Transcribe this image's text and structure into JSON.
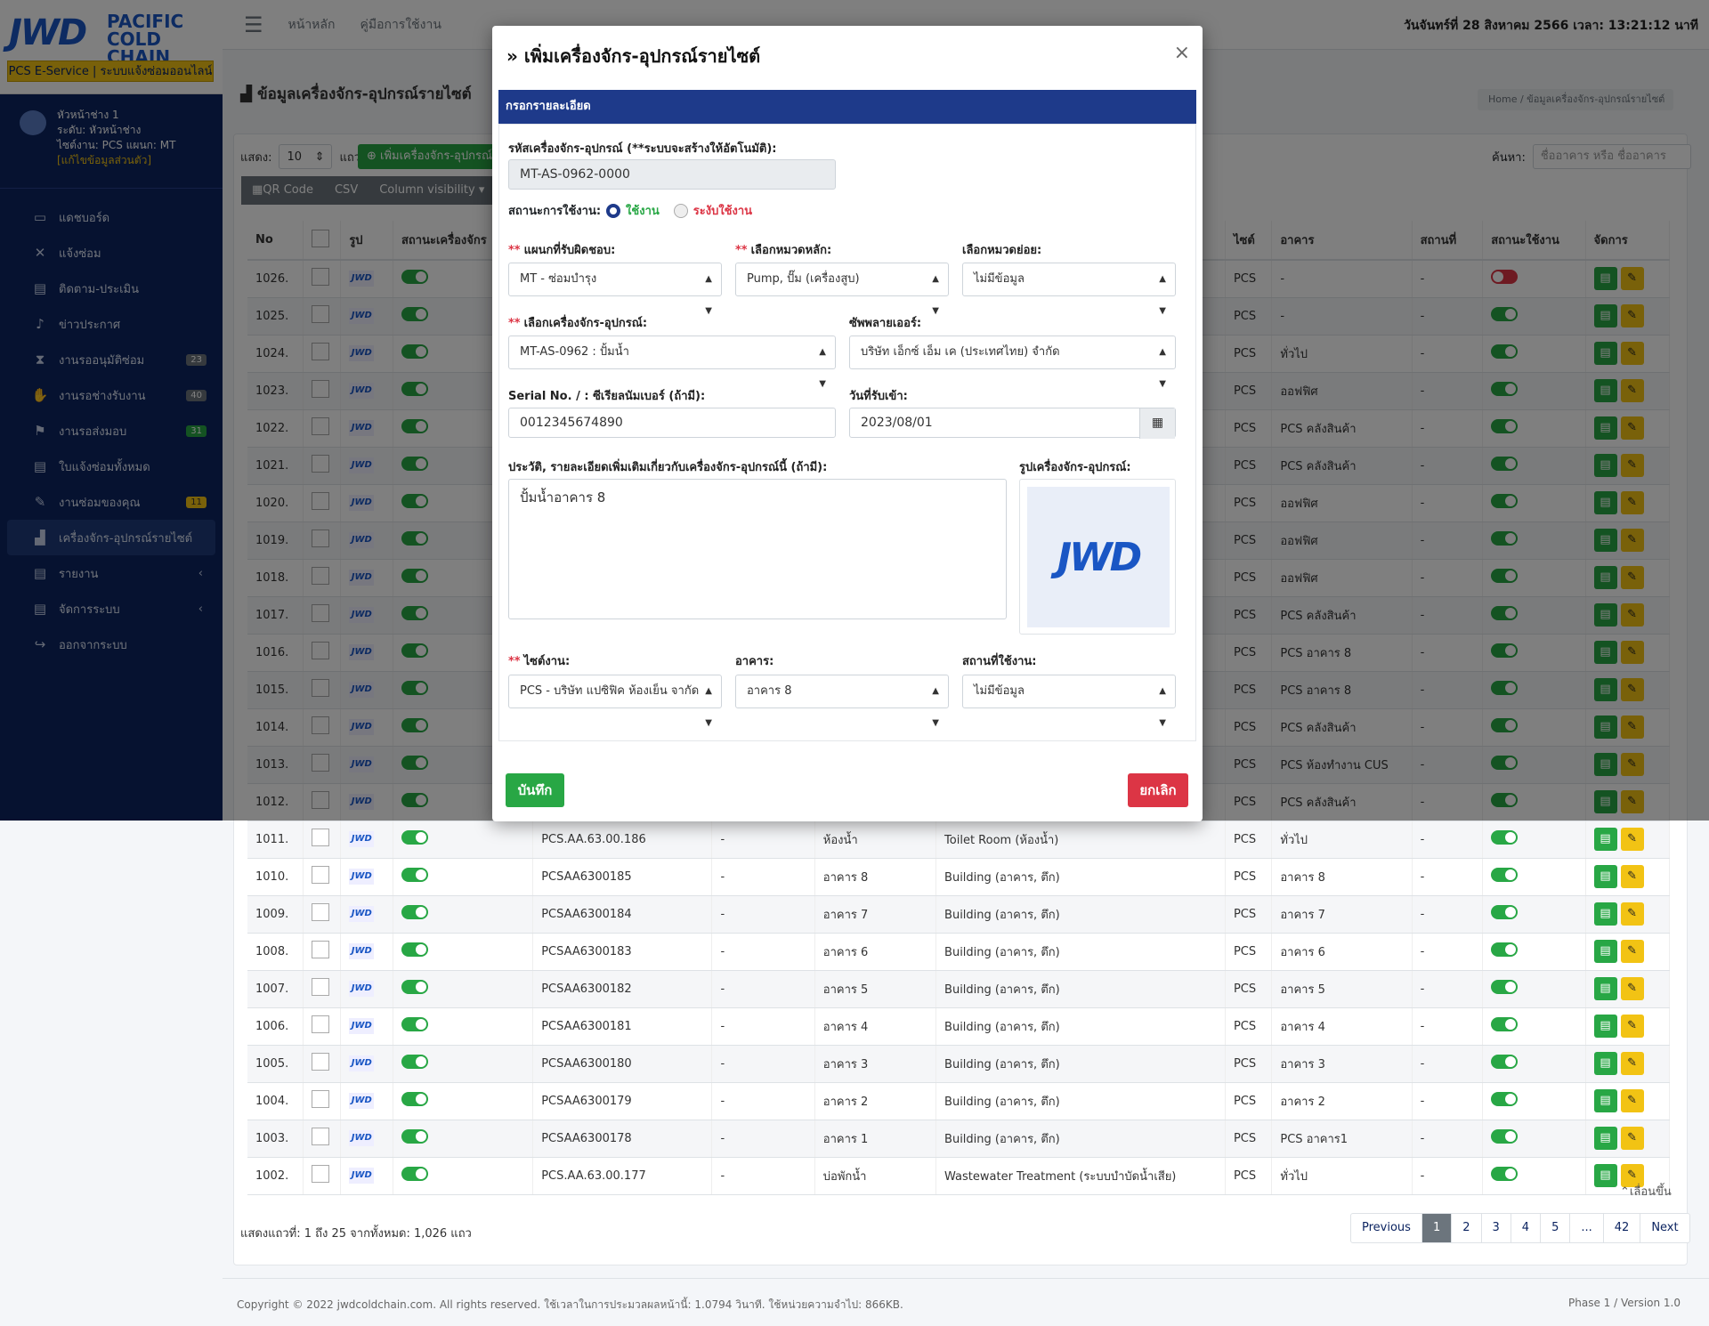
{
  "brand": {
    "logo": "JWD",
    "sub1": "PACIFIC",
    "sub2": "COLD CHAIN",
    "tagline": "PCS E-Service | ระบบแจ้งซ่อมออนไลน์"
  },
  "user": {
    "name": "หัวหน้าช่าง 1",
    "level": "ระดับ: หัวหน้าช่าง",
    "site": "ไซต์งาน: PCS แผนก: MT",
    "edit": "[แก้ไขข้อมูลส่วนตัว]"
  },
  "nav": [
    {
      "label": "แดชบอร์ด",
      "icon": "monitor-icon"
    },
    {
      "label": "แจ้งซ่อม",
      "icon": "tools-icon"
    },
    {
      "label": "ติดตาม-ประเมิน",
      "icon": "document-icon"
    },
    {
      "label": "ข่าวประกาศ",
      "icon": "bell-icon"
    },
    {
      "label": "งานรออนุมัติซ่อม",
      "icon": "hourglass-icon",
      "badge": "23"
    },
    {
      "label": "งานรอช่างรับงาน",
      "icon": "handshake-icon",
      "badge": "40"
    },
    {
      "label": "งานรอส่งมอบ",
      "icon": "flag-icon",
      "badge": "31"
    },
    {
      "label": "ใบแจ้งซ่อมทั้งหมด",
      "icon": "document-icon"
    },
    {
      "label": "งานซ่อมของคุณ",
      "icon": "wrench-icon",
      "badge": "11"
    },
    {
      "label": "เครื่องจักร-อุปกรณ์รายไซต์",
      "icon": "factory-icon"
    },
    {
      "label": "รายงาน",
      "icon": "document-icon"
    },
    {
      "label": "จัดการระบบ",
      "icon": "document-icon"
    },
    {
      "label": "ออกจากระบบ",
      "icon": "logout-icon"
    }
  ],
  "topbar": {
    "home": "หน้าหลัก",
    "manual": "คู่มือการใช้งาน",
    "datetime": "วันจันทร์ที่ 28 สิงหาคม 2566 เวลา: 13:21:12 นาที"
  },
  "page": {
    "title": "ข้อมูลเครื่องจักร-อุปกรณ์รายไซต์",
    "breadcrumb": "Home  /  ข้อมูลเครื่องจักร-อุปกรณ์รายไซต์"
  },
  "table_controls": {
    "show": "แสดง:",
    "rows": "แถว",
    "length": "10",
    "add": "เพิ่มเครื่องจักร-อุปกรณ์",
    "qr": "QR Code",
    "csv": "CSV",
    "colvis": "Column visibility",
    "search_label": "ค้นหา:",
    "search_placeholder": "ชื่ออาคาร หรือ ชื่ออาคาร"
  },
  "columns": [
    "No",
    "",
    "รูป",
    "สถานะเครื่องจักร",
    "",
    "",
    "",
    "",
    "ไซต์",
    "อาคาร",
    "สถานที่",
    "สถานะใช้งาน",
    "จัดการ"
  ],
  "rows": [
    {
      "no": "1026.",
      "code": "",
      "dash": "",
      "name": "",
      "type": "",
      "site": "PCS",
      "bld": "-",
      "loc": "-",
      "on": false
    },
    {
      "no": "1025.",
      "code": "",
      "dash": "",
      "name": "",
      "type": "",
      "site": "PCS",
      "bld": "-",
      "loc": "-",
      "on": true
    },
    {
      "no": "1024.",
      "code": "",
      "dash": "",
      "name": "",
      "type": "",
      "site": "PCS",
      "bld": "ทั่วไป",
      "loc": "-",
      "on": true
    },
    {
      "no": "1023.",
      "code": "",
      "dash": "",
      "name": "",
      "type": "",
      "site": "PCS",
      "bld": "ออฟฟิศ",
      "loc": "-",
      "on": true
    },
    {
      "no": "1022.",
      "code": "",
      "dash": "",
      "name": "",
      "type": "",
      "site": "PCS",
      "bld": "PCS คลังสินค้า",
      "loc": "-",
      "on": true
    },
    {
      "no": "1021.",
      "code": "",
      "dash": "",
      "name": "",
      "type": "",
      "site": "PCS",
      "bld": "PCS คลังสินค้า",
      "loc": "-",
      "on": true
    },
    {
      "no": "1020.",
      "code": "",
      "dash": "",
      "name": "",
      "type": "",
      "site": "PCS",
      "bld": "ออฟฟิศ",
      "loc": "-",
      "on": true
    },
    {
      "no": "1019.",
      "code": "",
      "dash": "",
      "name": "",
      "type": "",
      "site": "PCS",
      "bld": "ออฟฟิศ",
      "loc": "-",
      "on": true
    },
    {
      "no": "1018.",
      "code": "",
      "dash": "",
      "name": "",
      "type": "",
      "site": "PCS",
      "bld": "ออฟฟิศ",
      "loc": "-",
      "on": true
    },
    {
      "no": "1017.",
      "code": "",
      "dash": "",
      "name": "",
      "type": "",
      "site": "PCS",
      "bld": "PCS คลังสินค้า",
      "loc": "-",
      "on": true
    },
    {
      "no": "1016.",
      "code": "",
      "dash": "",
      "name": "",
      "type": "",
      "site": "PCS",
      "bld": "PCS อาคาร 8",
      "loc": "-",
      "on": true
    },
    {
      "no": "1015.",
      "code": "",
      "dash": "",
      "name": "",
      "type": "",
      "site": "PCS",
      "bld": "PCS อาคาร 8",
      "loc": "-",
      "on": true
    },
    {
      "no": "1014.",
      "code": "",
      "dash": "",
      "name": "",
      "type": "",
      "site": "PCS",
      "bld": "PCS คลังสินค้า",
      "loc": "-",
      "on": true
    },
    {
      "no": "1013.",
      "code": "",
      "dash": "",
      "name": "",
      "type": "",
      "site": "PCS",
      "bld": "PCS ห้องทำงาน CUS",
      "loc": "-",
      "on": true
    },
    {
      "no": "1012.",
      "code": "",
      "dash": "",
      "name": "",
      "type": "",
      "site": "PCS",
      "bld": "PCS คลังสินค้า",
      "loc": "-",
      "on": true
    },
    {
      "no": "1011.",
      "code": "PCS.AA.63.00.186",
      "dash": "-",
      "name": "ห้องน้ำ",
      "type": "Toilet Room (ห้องน้ำ)",
      "site": "PCS",
      "bld": "ทั่วไป",
      "loc": "-",
      "on": true
    },
    {
      "no": "1010.",
      "code": "PCSAA6300185",
      "dash": "-",
      "name": "อาคาร 8",
      "type": "Building (อาคาร, ตึก)",
      "site": "PCS",
      "bld": "อาคาร 8",
      "loc": "-",
      "on": true
    },
    {
      "no": "1009.",
      "code": "PCSAA6300184",
      "dash": "-",
      "name": "อาคาร 7",
      "type": "Building (อาคาร, ตึก)",
      "site": "PCS",
      "bld": "อาคาร 7",
      "loc": "-",
      "on": true
    },
    {
      "no": "1008.",
      "code": "PCSAA6300183",
      "dash": "-",
      "name": "อาคาร 6",
      "type": "Building (อาคาร, ตึก)",
      "site": "PCS",
      "bld": "อาคาร 6",
      "loc": "-",
      "on": true
    },
    {
      "no": "1007.",
      "code": "PCSAA6300182",
      "dash": "-",
      "name": "อาคาร 5",
      "type": "Building (อาคาร, ตึก)",
      "site": "PCS",
      "bld": "อาคาร 5",
      "loc": "-",
      "on": true
    },
    {
      "no": "1006.",
      "code": "PCSAA6300181",
      "dash": "-",
      "name": "อาคาร 4",
      "type": "Building (อาคาร, ตึก)",
      "site": "PCS",
      "bld": "อาคาร 4",
      "loc": "-",
      "on": true
    },
    {
      "no": "1005.",
      "code": "PCSAA6300180",
      "dash": "-",
      "name": "อาคาร 3",
      "type": "Building (อาคาร, ตึก)",
      "site": "PCS",
      "bld": "อาคาร 3",
      "loc": "-",
      "on": true
    },
    {
      "no": "1004.",
      "code": "PCSAA6300179",
      "dash": "-",
      "name": "อาคาร 2",
      "type": "Building (อาคาร, ตึก)",
      "site": "PCS",
      "bld": "อาคาร 2",
      "loc": "-",
      "on": true
    },
    {
      "no": "1003.",
      "code": "PCSAA6300178",
      "dash": "-",
      "name": "อาคาร 1",
      "type": "Building (อาคาร, ตึก)",
      "site": "PCS",
      "bld": "PCS อาคาร1",
      "loc": "-",
      "on": true
    },
    {
      "no": "1002.",
      "code": "PCS.AA.63.00.177",
      "dash": "-",
      "name": "บ่อพักน้ำ",
      "type": "Wastewater Treatment (ระบบบำบัดน้ำเสีย)",
      "site": "PCS",
      "bld": "ทั่วไป",
      "loc": "-",
      "on": true
    }
  ],
  "table_info": "แสดงแถวที่: 1 ถึง 25 จากทั้งหมด: 1,026 แถว",
  "pager": [
    "Previous",
    "1",
    "2",
    "3",
    "4",
    "5",
    "...",
    "42",
    "Next"
  ],
  "back_to_top": "เลื่อนขึ้น",
  "footer": {
    "left": "Copyright © 2022 jwdcoldchain.com. All rights reserved. ใช้เวลาในการประมวลผลหน้านี้: 1.0794 วินาที. ใช้หน่วยความจำไป: 866KB.",
    "right": "Phase 1 / Version 1.0"
  },
  "modal": {
    "title": "เพิ่มเครื่องจักร-อุปกรณ์รายไซต์",
    "section": "กรอกรายละเอียด",
    "code_label": "รหัสเครื่องจักร-อุปกรณ์ (**ระบบจะสร้างให้อัตโนมัติ):",
    "code_value": "MT-AS-0962-0000",
    "status_label": "สถานะการใช้งาน:",
    "status_on": "ใช้งาน",
    "status_off": "ระงับใช้งาน",
    "dept_label": "แผนกที่รับผิดชอบ:",
    "dept_value": "MT - ซ่อมบำรุง",
    "cat_label": "เลือกหมวดหลัก:",
    "cat_value": "Pump, ปั๊ม (เครื่องสูบ)",
    "subcat_label": "เลือกหมวดย่อย:",
    "subcat_value": "ไม่มีข้อมูล",
    "equip_label": "เลือกเครื่องจักร-อุปกรณ์:",
    "equip_value": "MT-AS-0962 : ปั้มน้ำ",
    "supplier_label": "ซัพพลายเออร์:",
    "supplier_value": "บริษัท เอ็กซ์ เอ็ม เค (ประเทศไทย) จำกัด",
    "serial_label": "Serial No. / : ซีเรียลนัมเบอร์ (ถ้ามี):",
    "serial_value": "0012345674890",
    "date_label": "วันที่รับเข้า:",
    "date_value": "2023/08/01",
    "desc_label": "ประวัติ, รายละเอียดเพิ่มเติมเกี่ยวกับเครื่องจักร-อุปกรณ์นี้ (ถ้ามี):",
    "desc_value": "ปั้มน้ำอาคาร 8",
    "img_label": "รูปเครื่องจักร-อุปกรณ์:",
    "img_logo": "JWD",
    "site_label": "ไซต์งาน:",
    "site_value": "PCS - บริษัท แปซิฟิค ห้องเย็น จากัด",
    "bld_label": "อาคาร:",
    "bld_value": "อาคาร 8",
    "loc_label": "สถานที่ใช้งาน:",
    "loc_value": "ไม่มีข้อมูล",
    "save": "บันทึก",
    "cancel": "ยกเลิก"
  }
}
